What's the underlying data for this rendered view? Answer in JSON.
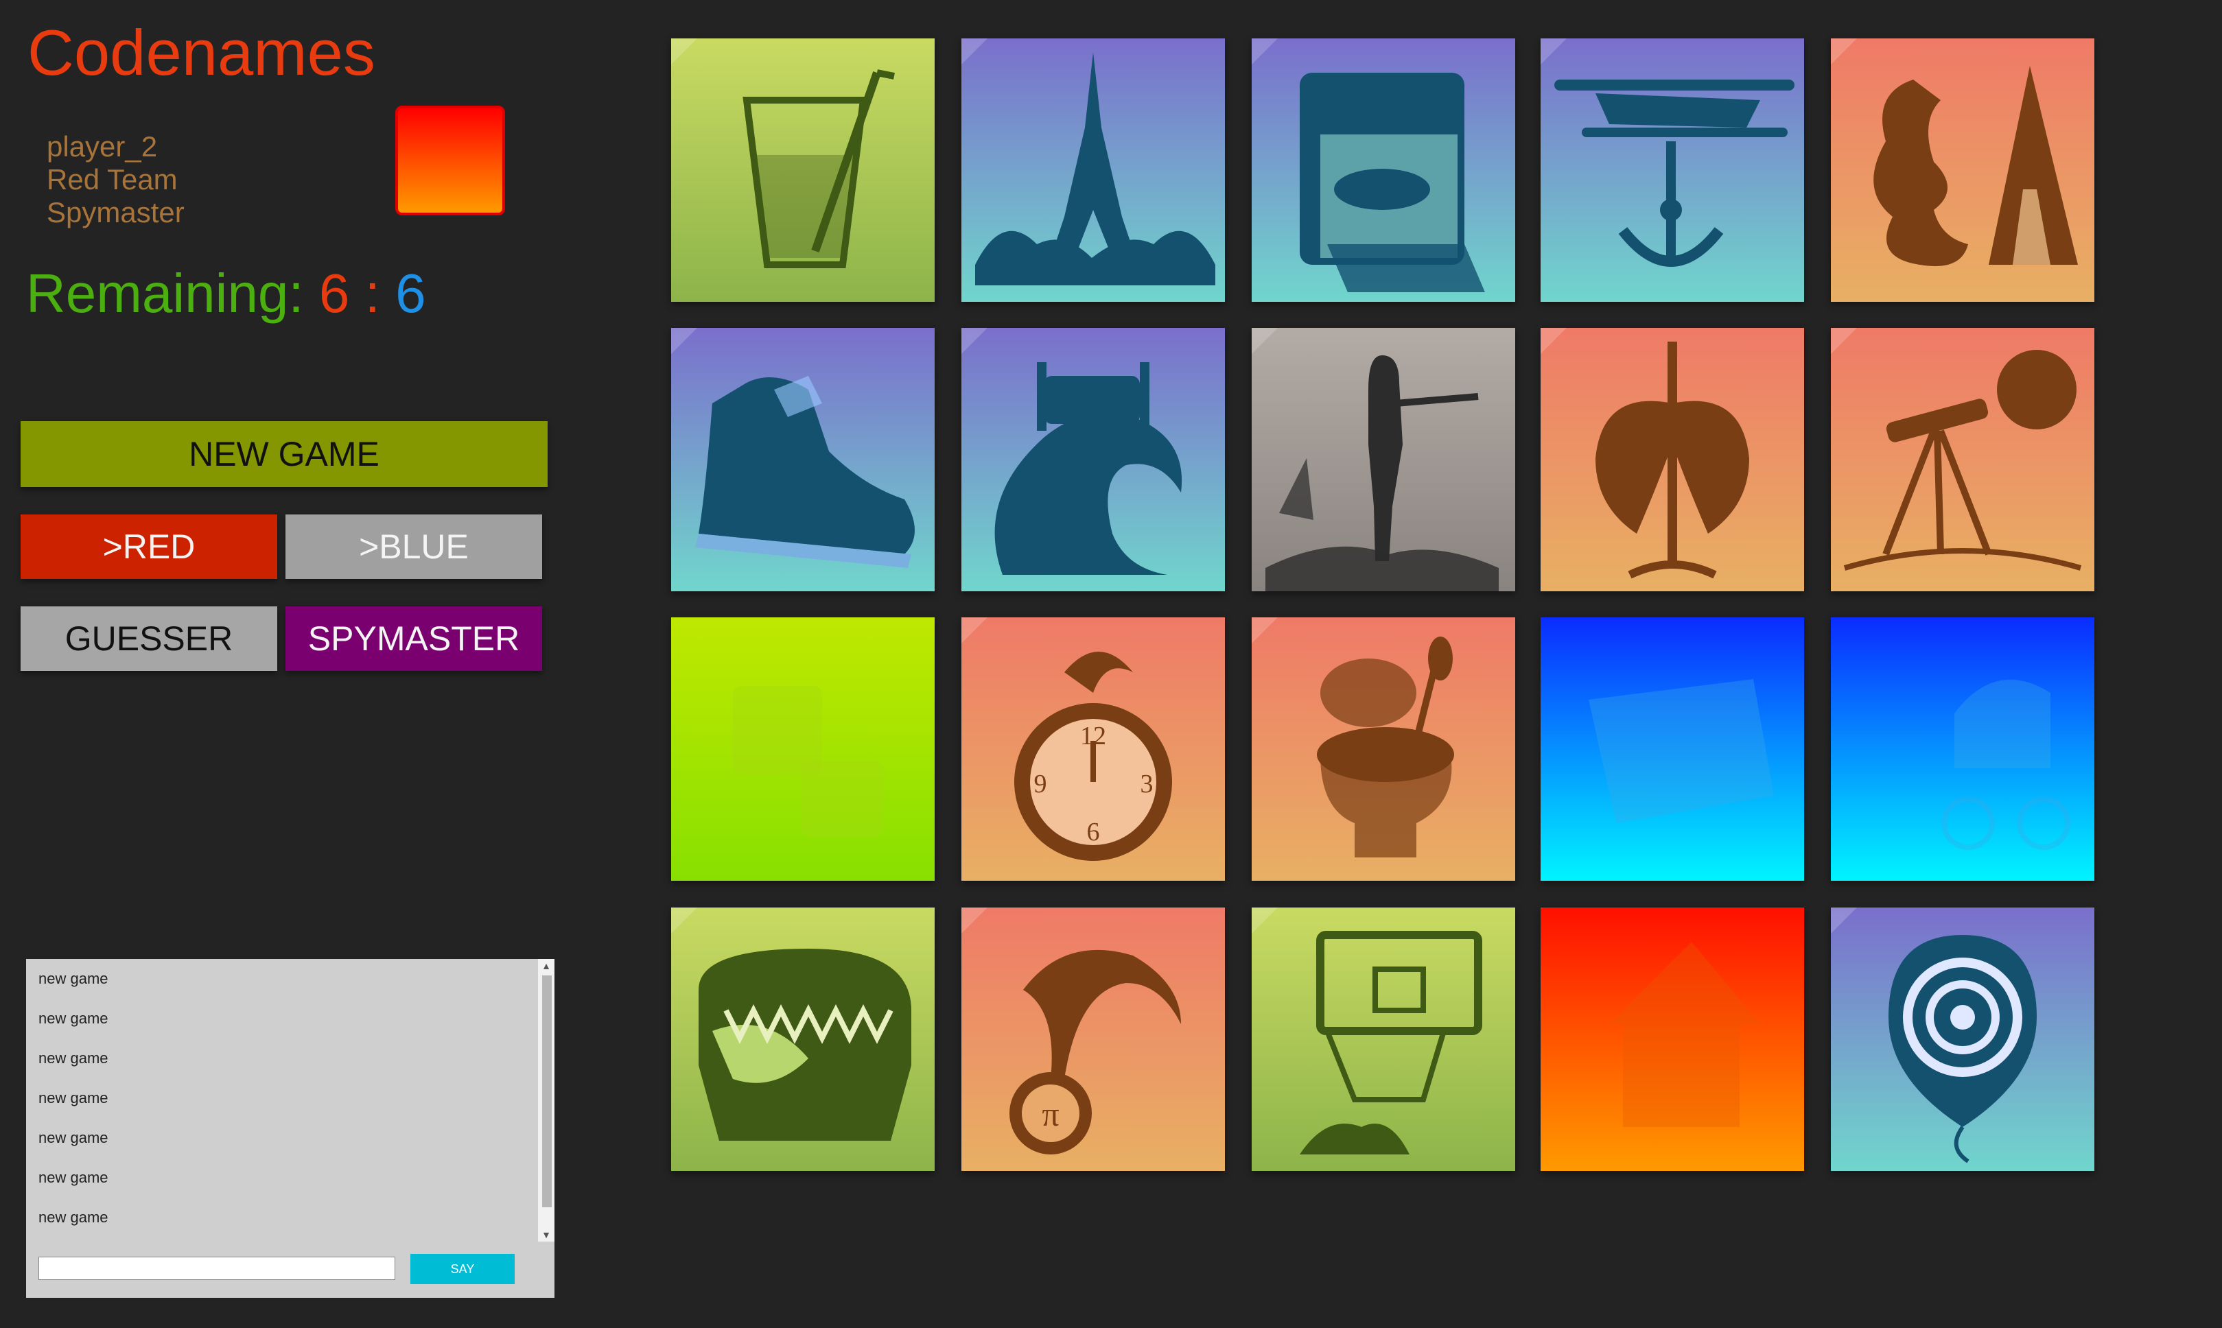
{
  "app": {
    "title": "Codenames"
  },
  "player": {
    "name": "player_2",
    "team": "Red Team",
    "role": "Spymaster",
    "team_color": "#ff3300"
  },
  "remaining": {
    "label": "Remaining:",
    "red": "6",
    "separator": ":",
    "blue": "6",
    "label_color": "#4caf10",
    "red_color": "#e83c10",
    "blue_color": "#1e90e6"
  },
  "buttons": {
    "new_game": "NEW GAME",
    "red": ">RED",
    "blue": ">BLUE",
    "guesser": "GUESSER",
    "spymaster": "SPYMASTER"
  },
  "chat": {
    "messages": [
      "new game",
      "new game",
      "new game",
      "new game",
      "new game",
      "new game",
      "new game"
    ],
    "say_label": "SAY",
    "input_value": ""
  },
  "board": {
    "cards": [
      {
        "subject": "drink-glass",
        "color": "neutral"
      },
      {
        "subject": "eiffel-tower",
        "color": "blue"
      },
      {
        "subject": "mailbox",
        "color": "blue"
      },
      {
        "subject": "biplane-anchor",
        "color": "blue"
      },
      {
        "subject": "dragon-teepee",
        "color": "red"
      },
      {
        "subject": "sneaker",
        "color": "blue"
      },
      {
        "subject": "bed-wave",
        "color": "blue"
      },
      {
        "subject": "hitchhiker",
        "color": "assassin"
      },
      {
        "subject": "coat-rack-wings",
        "color": "red"
      },
      {
        "subject": "telescope-planet",
        "color": "red"
      },
      {
        "subject": "puzzle-blocks",
        "color": "neutral-revealed"
      },
      {
        "subject": "alarm-clock",
        "color": "red"
      },
      {
        "subject": "toilet",
        "color": "red"
      },
      {
        "subject": "book",
        "color": "blue-revealed"
      },
      {
        "subject": "stroller-chain",
        "color": "blue-revealed"
      },
      {
        "subject": "treasure-chest-monster",
        "color": "neutral"
      },
      {
        "subject": "medal",
        "color": "red"
      },
      {
        "subject": "basketball-hoop",
        "color": "neutral"
      },
      {
        "subject": "birdhouse",
        "color": "red-revealed"
      },
      {
        "subject": "target-balloon",
        "color": "blue"
      }
    ]
  }
}
